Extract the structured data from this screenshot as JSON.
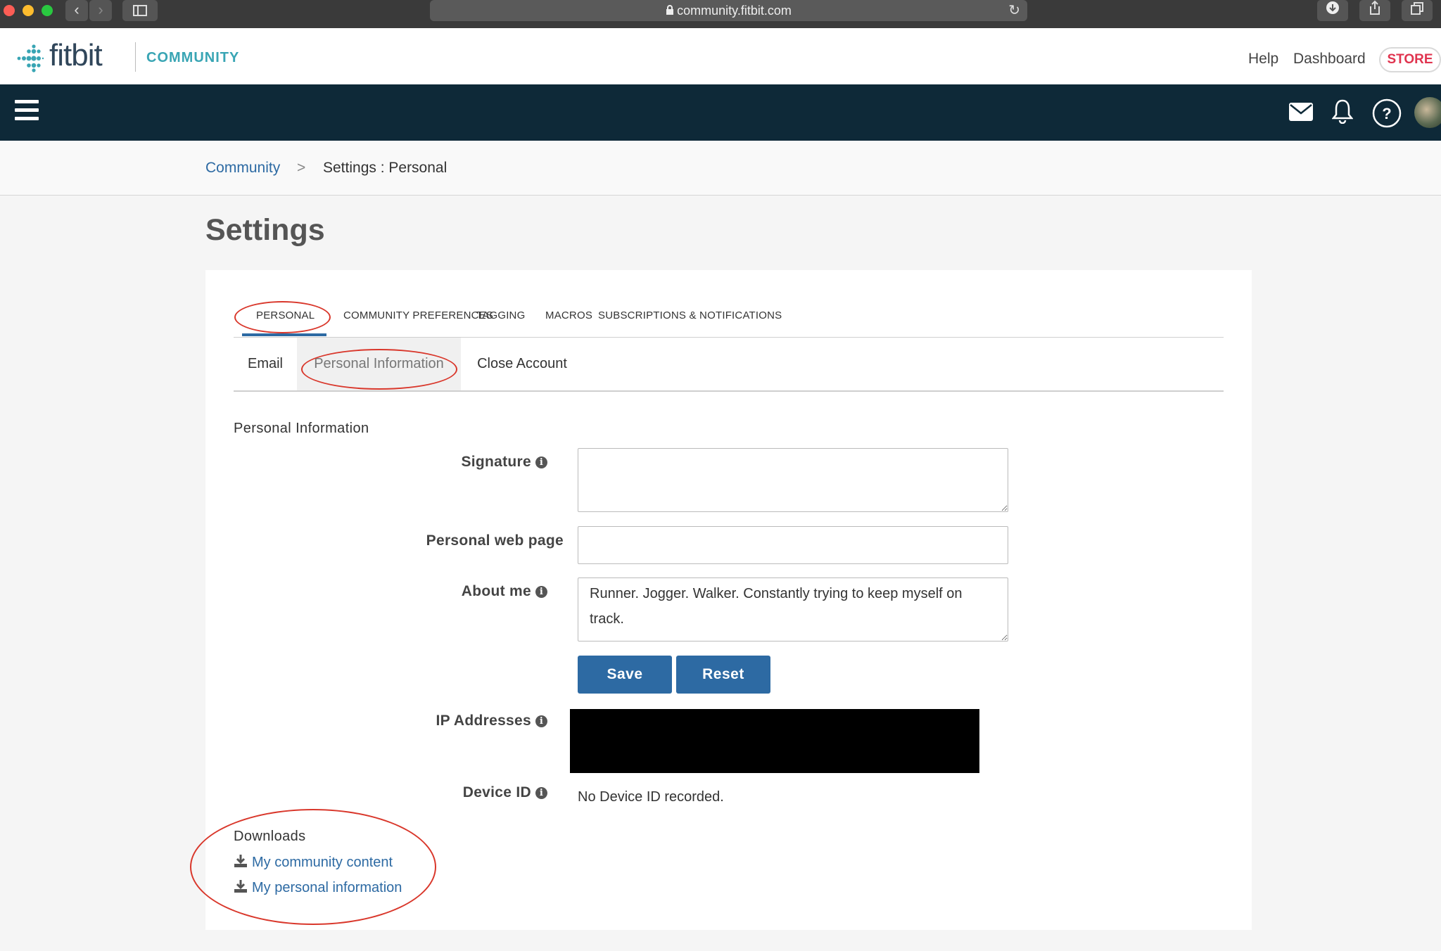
{
  "browser": {
    "url": "community.fitbit.com"
  },
  "header": {
    "logo_text": "fitbit",
    "community_label": "COMMUNITY",
    "help_link": "Help",
    "dashboard_link": "Dashboard",
    "store_button": "STORE"
  },
  "navbar": {
    "icons": [
      "menu-icon",
      "mail-icon",
      "bell-icon",
      "help-icon",
      "avatar"
    ]
  },
  "breadcrumb": {
    "root": "Community",
    "separator": ">",
    "current": "Settings : Personal"
  },
  "page": {
    "title": "Settings"
  },
  "tabs": [
    {
      "label": "PERSONAL",
      "active": true
    },
    {
      "label": "COMMUNITY PREFERENCES"
    },
    {
      "label": "TAGGING"
    },
    {
      "label": "MACROS"
    },
    {
      "label": "SUBSCRIPTIONS & NOTIFICATIONS"
    }
  ],
  "subtabs": [
    {
      "label": "Email"
    },
    {
      "label": "Personal Information",
      "active": true
    },
    {
      "label": "Close Account"
    }
  ],
  "form": {
    "section_title": "Personal Information",
    "signature_label": "Signature",
    "signature_value": "",
    "webpage_label": "Personal web page",
    "webpage_value": "",
    "about_label": "About me",
    "about_value": "Runner. Jogger. Walker. Constantly trying to keep myself on track.",
    "save_button": "Save",
    "reset_button": "Reset",
    "ip_label": "IP Addresses",
    "device_label": "Device ID",
    "device_value": "No Device ID recorded."
  },
  "downloads": {
    "title": "Downloads",
    "links": [
      "My community content",
      "My personal information"
    ]
  },
  "colors": {
    "link": "#2d6aa3",
    "navbar": "#0e2938",
    "button": "#2d6aa3",
    "annotation": "#d9372b",
    "store": "#e0344f",
    "community_accent": "#39a5b4"
  }
}
